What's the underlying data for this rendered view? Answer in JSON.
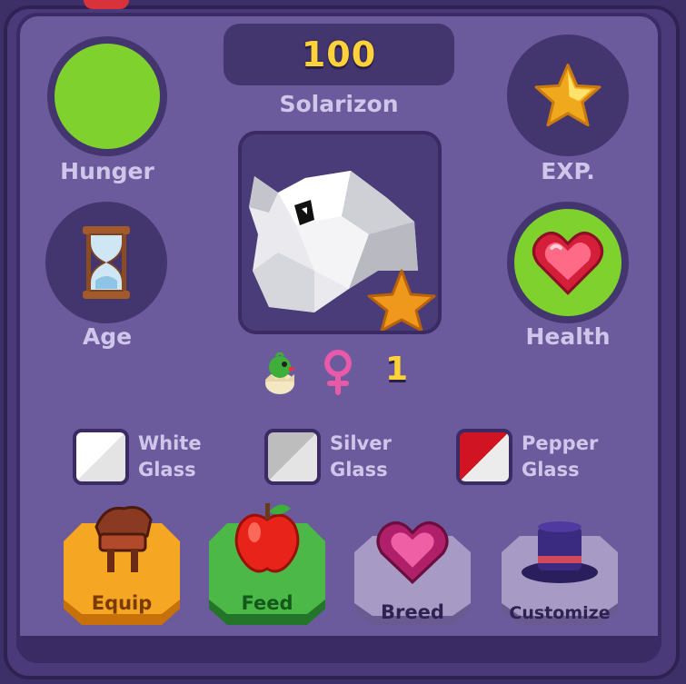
{
  "score": "100",
  "pet_name": "Solarizon",
  "stats": {
    "hunger": {
      "label": "Hunger",
      "color": "#7fd12e"
    },
    "exp": {
      "label": "EXP.",
      "icon": "star-icon"
    },
    "age": {
      "label": "Age",
      "icon": "hourglass-icon"
    },
    "health": {
      "label": "Health",
      "color": "#7fd12e",
      "icon": "heart-icon"
    }
  },
  "info_row": {
    "level": "1",
    "icons": [
      "hatchling-icon",
      "female-symbol-icon"
    ]
  },
  "genes": [
    {
      "line1": "White",
      "line2": "Glass",
      "color_a": "#ffffff",
      "color_b": "#e4e4e4"
    },
    {
      "line1": "Silver",
      "line2": "Glass",
      "color_a": "#bdbdbd",
      "color_b": "#e4e4e4"
    },
    {
      "line1": "Pepper",
      "line2": "Glass",
      "color_a": "#d01424",
      "color_b": "#ececec"
    }
  ],
  "buttons": {
    "equip": {
      "label": "Equip",
      "color": "#f5a623",
      "icon": "saddle-icon"
    },
    "feed": {
      "label": "Feed",
      "color": "#4cb848",
      "icon": "apple-icon"
    },
    "breed": {
      "label": "Breed",
      "color": "#a79bc6",
      "icon": "heart-gem-icon"
    },
    "customize": {
      "label": "Customize",
      "color": "#a79bc6",
      "icon": "top-hat-icon"
    }
  },
  "colors": {
    "panel": "#6b5a9c",
    "text": "#cfc6ea",
    "score": "#ffd23a"
  }
}
